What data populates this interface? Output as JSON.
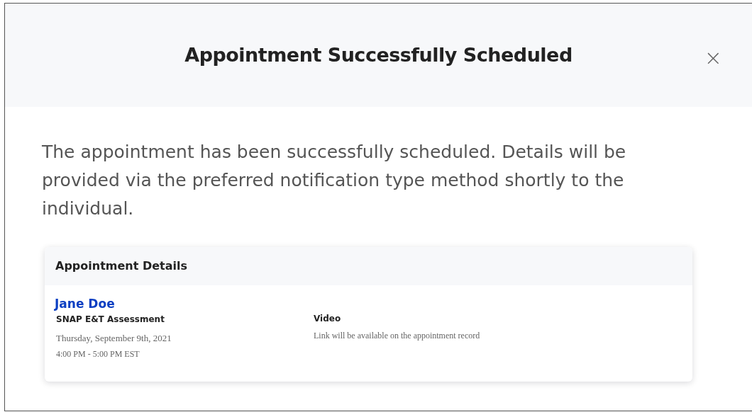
{
  "dialog": {
    "title": "Appointment Successfully Scheduled",
    "close": "×",
    "message": "The appointment has been successfully scheduled. Details will be provided via the preferred notification type method shortly to the individual."
  },
  "details": {
    "heading": "Appointment Details",
    "name": "Jane Doe",
    "type": "SNAP E&T Assessment",
    "date": "Thursday, September 9th, 2021",
    "time": "4:00 PM - 5:00 PM EST",
    "mode": "Video",
    "mode_note": "Link will be available on the appointment record"
  }
}
